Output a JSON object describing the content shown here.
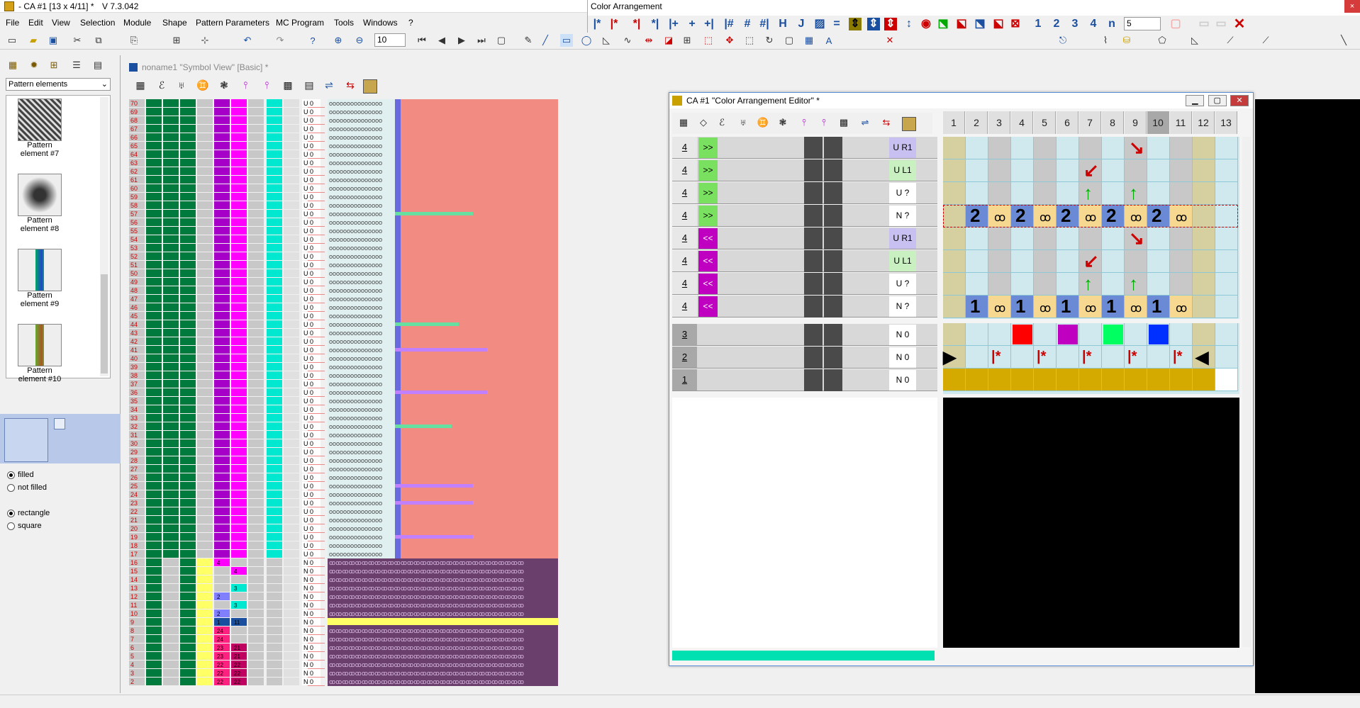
{
  "app": {
    "title": "- CA #1 [13 x 4/11] *",
    "version": "V 7.3.042"
  },
  "menu": [
    "File",
    "Edit",
    "View",
    "Selection",
    "Module",
    "Shape",
    "Pattern Parameters",
    "MC Program",
    "Tools",
    "Windows",
    "?"
  ],
  "toolbar": {
    "zoom_value": "10"
  },
  "left_panel": {
    "dropdown": "Pattern elements",
    "elements": [
      {
        "label": "Pattern element #7"
      },
      {
        "label": "Pattern element #8"
      },
      {
        "label": "Pattern element #9"
      },
      {
        "label": "Pattern element #10"
      }
    ],
    "fill_options": [
      "filled",
      "not filled"
    ],
    "shape_options": [
      "rectangle",
      "square"
    ],
    "fill_selected": "filled",
    "shape_selected": "rectangle"
  },
  "symbol_view": {
    "title": "noname1 \"Symbol View\" [Basic] *",
    "rows_top": [
      "70",
      "69",
      "68",
      "67",
      "66",
      "65",
      "64",
      "63",
      "62",
      "61",
      "60",
      "59",
      "58",
      "57",
      "56",
      "55",
      "54",
      "53",
      "52",
      "51",
      "50",
      "49",
      "48",
      "47",
      "46",
      "45",
      "44",
      "43",
      "42",
      "41",
      "40",
      "39",
      "38",
      "37",
      "36",
      "35",
      "34",
      "33",
      "32",
      "31",
      "30",
      "29",
      "28",
      "27",
      "26",
      "25",
      "24",
      "23",
      "22",
      "21",
      "20",
      "19",
      "18",
      "17"
    ],
    "rows_bottom": [
      "16",
      "15",
      "14",
      "13",
      "12",
      "11",
      "10",
      "9",
      "8",
      "7",
      "6",
      "5",
      "4",
      "3",
      "2"
    ],
    "u_label": "U 0",
    "n_label": "N 0",
    "bottom_codes": [
      {
        "row": "16",
        "a": "4",
        "b": ""
      },
      {
        "row": "15",
        "a": "",
        "b": "4"
      },
      {
        "row": "14",
        "a": "",
        "b": ""
      },
      {
        "row": "13",
        "a": "",
        "b": "3"
      },
      {
        "row": "12",
        "a": "2",
        "b": ""
      },
      {
        "row": "11",
        "a": "",
        "b": "3"
      },
      {
        "row": "10",
        "a": "2",
        "b": ""
      },
      {
        "row": "9",
        "a": "1",
        "b": "11"
      },
      {
        "row": "8",
        "a": "24",
        "b": ""
      },
      {
        "row": "7",
        "a": "24",
        "b": ""
      },
      {
        "row": "6",
        "a": "23",
        "b": "21"
      },
      {
        "row": "5",
        "a": "23",
        "b": "21"
      },
      {
        "row": "4",
        "a": "22",
        "b": "22"
      },
      {
        "row": "3",
        "a": "22",
        "b": "22"
      },
      {
        "row": "2",
        "a": "22",
        "b": "22"
      }
    ]
  },
  "color_arrangement": {
    "palette_title": "Color Arrangement",
    "palette_num_buttons": [
      "1",
      "2",
      "3",
      "4"
    ],
    "palette_select": "5",
    "editor_title": "CA #1 \"Color Arrangement Editor\" *",
    "columns": [
      "1",
      "2",
      "3",
      "4",
      "5",
      "6",
      "7",
      "8",
      "9",
      "10",
      "11",
      "12",
      "13"
    ],
    "selected_column": "10",
    "upper_rows": [
      {
        "num": "4",
        "dir": ">>",
        "label": "U R1"
      },
      {
        "num": "4",
        "dir": ">>",
        "label": "U L1"
      },
      {
        "num": "4",
        "dir": ">>",
        "label": "U ?"
      },
      {
        "num": "4",
        "dir": ">>",
        "label": "N ?"
      },
      {
        "num": "4",
        "dir": "<<",
        "label": "U R1"
      },
      {
        "num": "4",
        "dir": "<<",
        "label": "U L1"
      },
      {
        "num": "4",
        "dir": "<<",
        "label": "U ?"
      },
      {
        "num": "4",
        "dir": "<<",
        "label": "N ?"
      }
    ],
    "lower_rows": [
      {
        "num": "3",
        "label": "N 0"
      },
      {
        "num": "2",
        "label": "N 0"
      },
      {
        "num": "1",
        "label": "N 0"
      }
    ],
    "grid_digits": {
      "row4": "2",
      "row8": "1"
    },
    "swatch_colors": [
      "#ff0000",
      "#c000c0",
      "#00ff60",
      "#0030ff"
    ],
    "marker": "*"
  },
  "colors": {
    "green": "#007a3d",
    "magenta": "#a600c8",
    "pink": "#ff00ff",
    "cyan": "#00e8d0",
    "salmon": "#f28b82",
    "yellow": "#ffff66",
    "purple_dark": "#6a3f6b",
    "blue_pattern": "#6a6adf"
  }
}
